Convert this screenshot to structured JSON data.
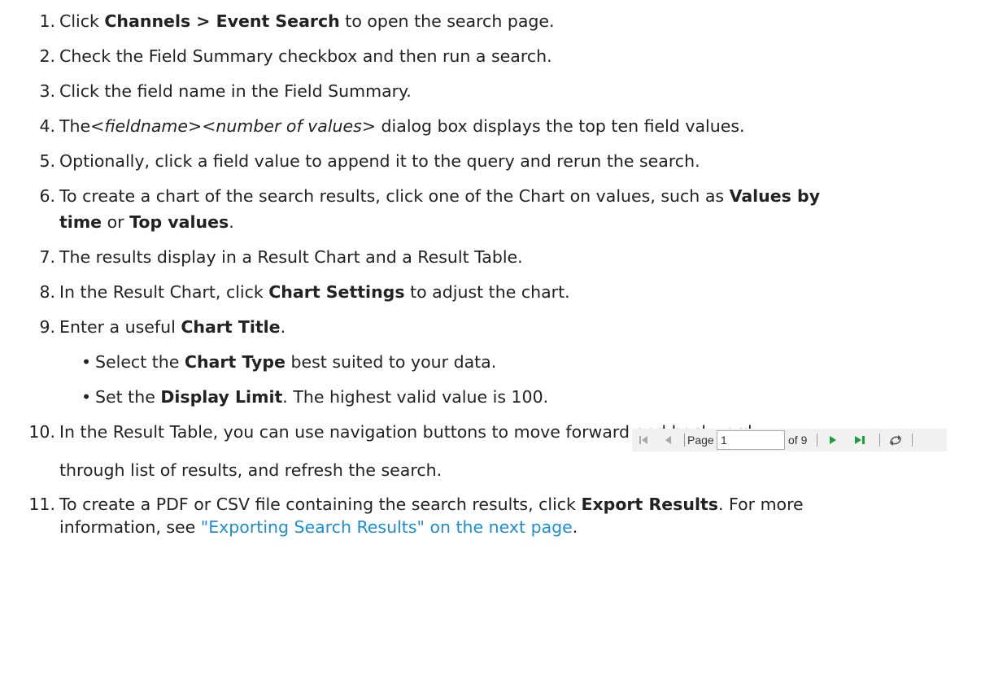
{
  "steps": {
    "s1": {
      "num": "1.",
      "a": "Click ",
      "b1": "Channels > Event Search",
      "c": " to open the search page."
    },
    "s2": {
      "num": "2.",
      "a": "Check the Field Summary checkbox and then run a search."
    },
    "s3": {
      "num": "3.",
      "a": "Click the field name in the Field Summary."
    },
    "s4": {
      "num": "4.",
      "a": "The",
      "i1": "<fieldname><number of values>",
      "c": " dialog box displays the top ten field values."
    },
    "s5": {
      "num": "5.",
      "a": "Optionally, click a field value to append it to the query and rerun the search."
    },
    "s6": {
      "num": "6.",
      "a": "To create a chart of the search results, click one of the Chart on values, such as ",
      "b1": "Values by",
      "b2": "time",
      "c": " or ",
      "b3": "Top values",
      "d": "."
    },
    "s7": {
      "num": "7.",
      "a": "The results display in a Result Chart and a Result Table."
    },
    "s8": {
      "num": "8.",
      "a": "In the Result Chart, click ",
      "b1": "Chart Settings",
      "c": " to adjust the chart."
    },
    "s9": {
      "num": "9.",
      "a": "Enter a useful ",
      "b1": "Chart Title",
      "c": "."
    },
    "s9_sub1": {
      "a": "Select the ",
      "b1": "Chart Type",
      "c": " best suited to your data."
    },
    "s9_sub2": {
      "a": "Set the ",
      "b1": "Display Limit",
      "c": ". The highest valid value is 100."
    },
    "s10": {
      "num": "10.",
      "a": "In the Result Table, you can use navigation buttons to move forward and backward",
      "line2": "through list of results, and refresh the search."
    },
    "s11": {
      "num": "11.",
      "a": "To create a PDF or CSV file containing the search results, click ",
      "b1": "Export Results",
      "c": ". For more",
      "line2a": "information, see ",
      "link": "\"Exporting Search Results\" on the next page",
      "line2b": "."
    }
  },
  "pager": {
    "page_label": "Page",
    "page_value": "1",
    "of_label": "of 9",
    "first_icon": "first-page-icon",
    "prev_icon": "previous-page-icon",
    "next_icon": "next-page-icon",
    "last_icon": "last-page-icon",
    "refresh_icon": "refresh-icon",
    "next_color": "#1a9e3a"
  }
}
